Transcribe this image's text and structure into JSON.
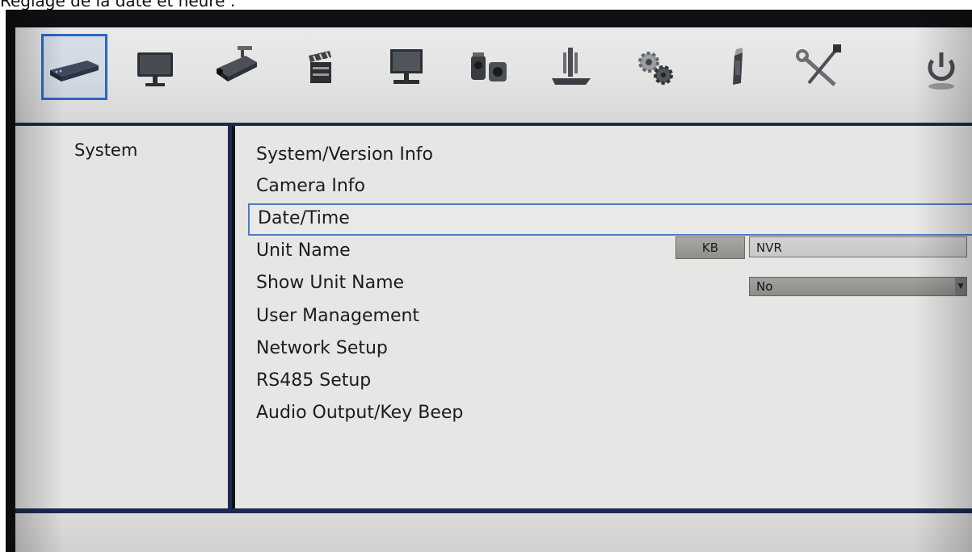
{
  "caption": "Réglage de la date et heure :",
  "icons": [
    {
      "name": "system-dvr-icon",
      "selected": true
    },
    {
      "name": "display-monitor-icon"
    },
    {
      "name": "camera-icon"
    },
    {
      "name": "record-clapper-icon"
    },
    {
      "name": "device-monitor-icon"
    },
    {
      "name": "ptz-camera-icon"
    },
    {
      "name": "storage-device-icon"
    },
    {
      "name": "gear-icon"
    },
    {
      "name": "usb-stick-icon"
    },
    {
      "name": "tools-icon"
    },
    {
      "name": "power-icon"
    }
  ],
  "left_panel": {
    "title": "System"
  },
  "menu": {
    "items": [
      "System/Version Info",
      "Camera Info",
      "Date/Time",
      "Unit Name",
      "Show Unit Name",
      "User Management",
      "Network Setup",
      "RS485 Setup",
      "Audio Output/Key Beep"
    ],
    "selected_index": 2
  },
  "unit_name": {
    "keyboard_label": "KB",
    "value": "NVR"
  },
  "show_unit_name": {
    "selected": "No"
  },
  "colors": {
    "accent_blue": "#2b67c4",
    "frame_navy": "#1c2a52",
    "panel_gray": "#e4e4e3"
  }
}
